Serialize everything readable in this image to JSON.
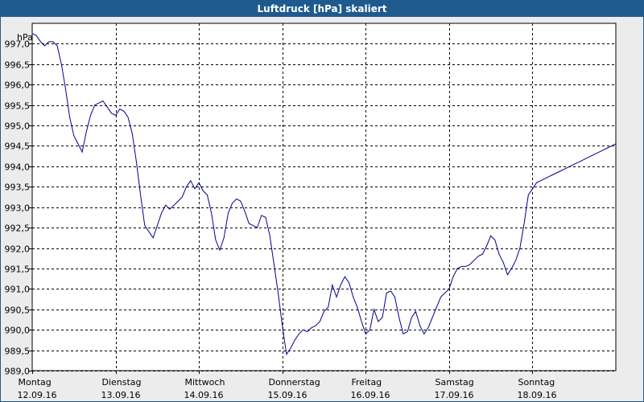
{
  "window": {
    "title": "Luftdruck [hPa] skaliert"
  },
  "chart_data": {
    "type": "line",
    "title": "Luftdruck [hPa] skaliert",
    "ylabel": "hPa",
    "xlabel": "",
    "ylim": [
      989.0,
      997.5
    ],
    "yticks": [
      {
        "value": 997.0,
        "label": "997,0"
      },
      {
        "value": 996.5,
        "label": "996,5"
      },
      {
        "value": 996.0,
        "label": "996,0"
      },
      {
        "value": 995.5,
        "label": "995,5"
      },
      {
        "value": 995.0,
        "label": "995,0"
      },
      {
        "value": 994.5,
        "label": "994,5"
      },
      {
        "value": 994.0,
        "label": "994,0"
      },
      {
        "value": 993.5,
        "label": "993,5"
      },
      {
        "value": 993.0,
        "label": "993,0"
      },
      {
        "value": 992.5,
        "label": "992,5"
      },
      {
        "value": 992.0,
        "label": "992,0"
      },
      {
        "value": 991.5,
        "label": "991,5"
      },
      {
        "value": 991.0,
        "label": "991,0"
      },
      {
        "value": 990.5,
        "label": "990,5"
      },
      {
        "value": 990.0,
        "label": "990,0"
      },
      {
        "value": 989.5,
        "label": "989,5"
      },
      {
        "value": 989.0,
        "label": "989,0"
      }
    ],
    "xlim": [
      0,
      7
    ],
    "xticks": [
      {
        "day": "Montag",
        "date": "12.09.16"
      },
      {
        "day": "Dienstag",
        "date": "13.09.16"
      },
      {
        "day": "Mittwoch",
        "date": "14.09.16"
      },
      {
        "day": "Donnerstag",
        "date": "15.09.16"
      },
      {
        "day": "Freitag",
        "date": "16.09.16"
      },
      {
        "day": "Samstag",
        "date": "17.09.16"
      },
      {
        "day": "Sonntag",
        "date": "18.09.16"
      }
    ],
    "grid": true,
    "line_color": "#00008b",
    "series": [
      {
        "x": [
          0.0,
          0.05,
          0.1,
          0.15,
          0.2,
          0.25,
          0.3,
          0.35,
          0.4,
          0.45,
          0.5,
          0.55,
          0.6,
          0.65,
          0.7,
          0.75,
          0.8,
          0.85,
          0.9,
          0.95,
          1.0,
          1.05,
          1.1,
          1.15,
          1.2,
          1.25,
          1.3,
          1.35,
          1.4,
          1.45,
          1.5,
          1.55,
          1.6,
          1.65,
          1.7,
          1.75,
          1.8,
          1.85,
          1.9,
          1.95,
          2.0,
          2.05,
          2.1,
          2.15,
          2.2,
          2.25,
          2.3,
          2.35,
          2.4,
          2.45,
          2.5,
          2.55,
          2.6,
          2.65,
          2.7,
          2.75,
          2.8,
          2.85,
          2.9,
          2.95,
          3.0,
          3.05,
          3.1,
          3.15,
          3.2,
          3.25,
          3.3,
          3.35,
          3.4,
          3.45,
          3.5,
          3.55,
          3.6,
          3.65,
          3.7,
          3.75,
          3.8,
          3.85,
          3.9,
          3.95,
          4.0,
          4.05,
          4.1,
          4.15,
          4.2,
          4.25,
          4.3,
          4.35,
          4.4,
          4.45,
          4.5,
          4.55,
          4.6,
          4.65,
          4.7,
          4.75,
          4.8,
          4.85,
          4.9,
          4.95,
          5.0,
          5.05,
          5.1,
          5.15,
          5.2,
          5.25,
          5.3,
          5.35,
          5.4,
          5.45,
          5.5,
          5.55,
          5.6,
          5.65,
          5.7,
          5.75,
          5.8,
          5.85,
          5.9,
          5.95,
          6.0,
          6.05,
          6.1,
          6.15,
          6.2,
          6.25,
          6.3,
          6.35,
          6.4,
          6.45,
          6.5,
          6.55,
          6.6,
          6.65,
          6.7,
          6.75,
          6.8,
          6.85,
          6.9,
          6.95,
          7.0
        ],
        "values": [
          997.25,
          997.2,
          997.05,
          996.95,
          997.05,
          997.05,
          996.95,
          996.5,
          995.9,
          995.2,
          994.75,
          994.55,
          994.35,
          994.85,
          995.25,
          995.5,
          995.55,
          995.6,
          995.45,
          995.3,
          995.25,
          995.4,
          995.35,
          995.2,
          994.8,
          994.1,
          993.3,
          992.55,
          992.4,
          992.25,
          992.55,
          992.85,
          993.05,
          992.95,
          993.05,
          993.15,
          993.25,
          993.5,
          993.65,
          993.45,
          993.6,
          993.4,
          993.3,
          992.85,
          992.2,
          991.95,
          992.25,
          992.85,
          993.1,
          993.2,
          993.15,
          992.9,
          992.6,
          992.55,
          992.5,
          992.8,
          992.75,
          992.3,
          991.6,
          990.9,
          990.1,
          989.4,
          989.55,
          989.75,
          989.9,
          990.0,
          989.95,
          990.05,
          990.1,
          990.2,
          990.45,
          990.55,
          991.1,
          990.8,
          991.1,
          991.3,
          991.15,
          990.8,
          990.55,
          990.2,
          989.9,
          990.0,
          990.5,
          990.2,
          990.3,
          990.9,
          990.95,
          990.8,
          990.3,
          989.9,
          989.95,
          990.3,
          990.45,
          990.1,
          989.9,
          990.05,
          990.3,
          990.55,
          990.8,
          990.9,
          991.0,
          991.3,
          991.5,
          991.55,
          991.55,
          991.6,
          991.7,
          991.8,
          991.85,
          992.05,
          992.3,
          992.2,
          991.85,
          991.65,
          991.35,
          991.5,
          991.7,
          992.0,
          992.6,
          993.3,
          993.45,
          993.6,
          993.65,
          993.7,
          993.75,
          993.8,
          993.85,
          993.9,
          993.95,
          994.0,
          994.05,
          994.1,
          994.15,
          994.2,
          994.25,
          994.3,
          994.35,
          994.4,
          994.45,
          994.5,
          994.55
        ]
      }
    ]
  }
}
